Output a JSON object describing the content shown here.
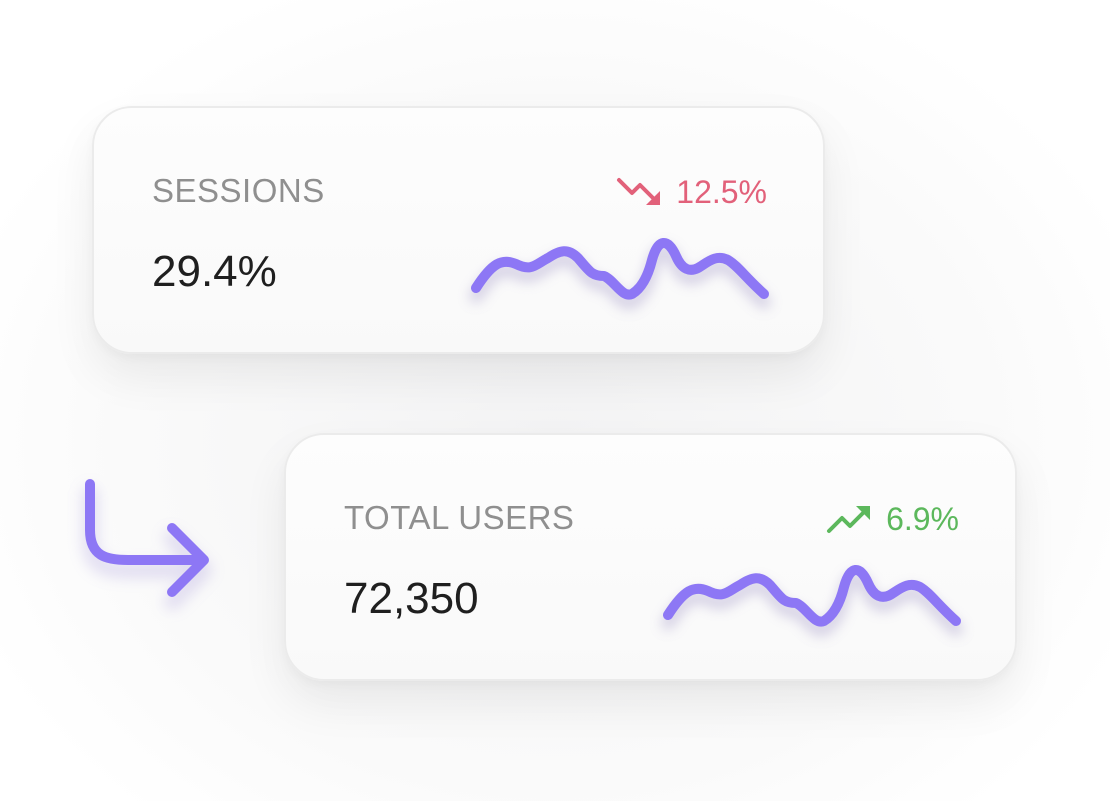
{
  "cards": {
    "sessions": {
      "title": "SESSIONS",
      "value": "29.4%",
      "trend": {
        "direction": "down",
        "text": "12.5%",
        "icon": "trending-down-icon",
        "color": "#e2617a"
      }
    },
    "total_users": {
      "title": "TOTAL USERS",
      "value": "72,350",
      "trend": {
        "direction": "up",
        "text": "6.9%",
        "icon": "trending-up-icon",
        "color": "#5cb85c"
      }
    }
  },
  "sparkline_color": "#8d77f5",
  "connector_icon": "corner-down-right-arrow-icon"
}
